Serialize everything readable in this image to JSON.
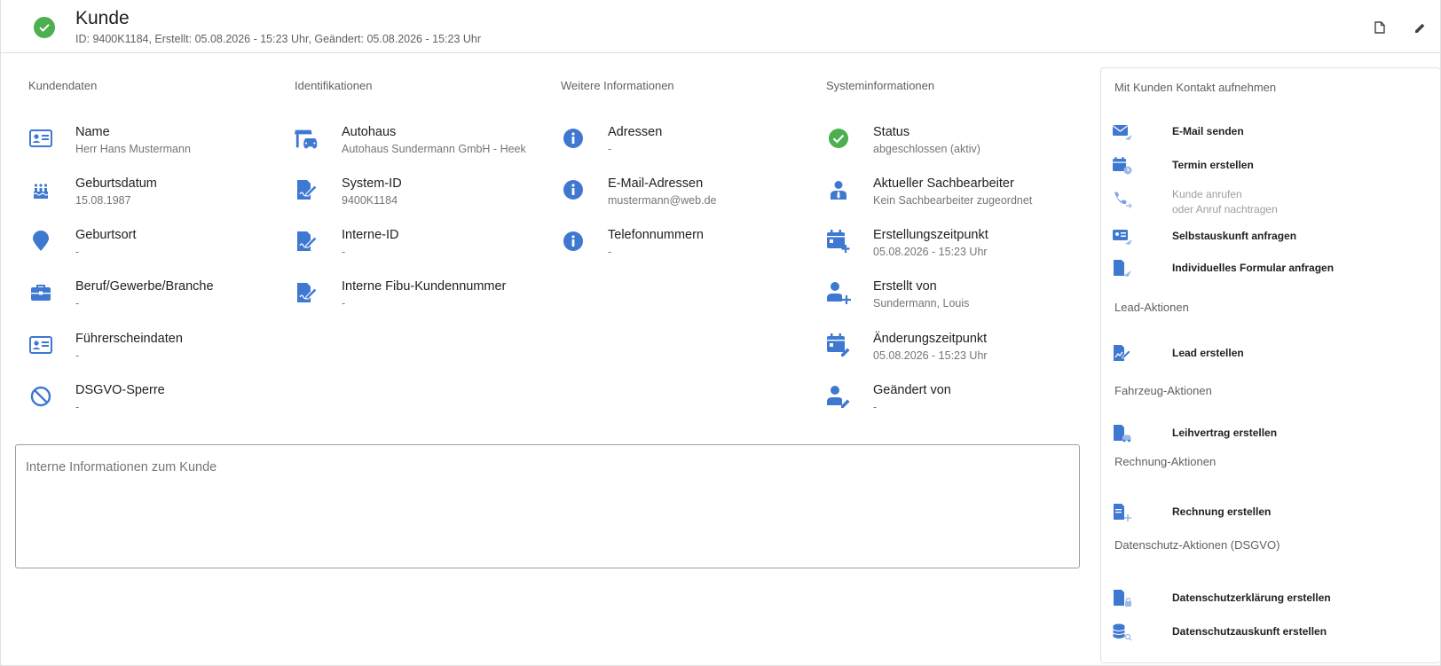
{
  "header": {
    "title": "Kunde",
    "subtitle": "ID: 9400K1184, Erstellt: 05.08.2026 - 15:23 Uhr, Geändert: 05.08.2026 - 15:23 Uhr"
  },
  "columns": [
    {
      "title": "Kundendaten",
      "items": [
        {
          "label": "Name",
          "value": "Herr Hans Mustermann",
          "icon": "id-card-icon"
        },
        {
          "label": "Geburtsdatum",
          "value": "15.08.1987",
          "icon": "cake-icon"
        },
        {
          "label": "Geburtsort",
          "value": "-",
          "icon": "location-pin-icon"
        },
        {
          "label": "Beruf/Gewerbe/Branche",
          "value": "-",
          "icon": "briefcase-icon"
        },
        {
          "label": "Führerscheindaten",
          "value": "-",
          "icon": "license-card-icon"
        },
        {
          "label": "DSGVO-Sperre",
          "value": "-",
          "icon": "block-icon"
        }
      ]
    },
    {
      "title": "Identifikationen",
      "items": [
        {
          "label": "Autohaus",
          "value": "Autohaus Sundermann GmbH - Heek",
          "icon": "car-dealership-icon"
        },
        {
          "label": "System-ID",
          "value": "9400K1184",
          "icon": "document-sign-icon"
        },
        {
          "label": "Interne-ID",
          "value": "-",
          "icon": "document-sign-icon"
        },
        {
          "label": "Interne Fibu-Kundennummer",
          "value": "-",
          "icon": "document-sign-icon"
        }
      ]
    },
    {
      "title": "Weitere Informationen",
      "items": [
        {
          "label": "Adressen",
          "value": "-",
          "icon": "info-icon"
        },
        {
          "label": "E-Mail-Adressen",
          "value": "mustermann@web.de",
          "icon": "info-icon"
        },
        {
          "label": "Telefonnummern",
          "value": "-",
          "icon": "info-icon"
        }
      ]
    },
    {
      "title": "Systeminformationen",
      "items": [
        {
          "label": "Status",
          "value": "abgeschlossen (aktiv)",
          "icon": "check-circle-icon"
        },
        {
          "label": "Aktueller Sachbearbeiter",
          "value": "Kein Sachbearbeiter zugeordnet",
          "icon": "agent-icon"
        },
        {
          "label": "Erstellungszeitpunkt",
          "value": "05.08.2026 - 15:23 Uhr",
          "icon": "calendar-add-icon"
        },
        {
          "label": "Erstellt von",
          "value": "Sundermann, Louis",
          "icon": "person-add-icon"
        },
        {
          "label": "Änderungszeitpunkt",
          "value": "05.08.2026 - 15:23 Uhr",
          "icon": "calendar-edit-icon"
        },
        {
          "label": "Geändert von",
          "value": "-",
          "icon": "person-edit-icon"
        }
      ]
    }
  ],
  "notes": {
    "placeholder": "Interne Informationen zum Kunde"
  },
  "panel": {
    "contact_title": "Mit Kunden Kontakt aufnehmen",
    "contact_actions": [
      {
        "label": "E-Mail senden",
        "icon": "email-send-icon"
      },
      {
        "label": "Termin erstellen",
        "icon": "calendar-time-icon"
      },
      {
        "label": "Kunde anrufen",
        "label2": "oder Anruf nachtragen",
        "icon": "phone-icon",
        "disabled": true
      },
      {
        "label": "Selbstauskunft anfragen",
        "icon": "self-disclosure-icon"
      },
      {
        "label": "Individuelles Formular anfragen",
        "icon": "form-request-icon"
      }
    ],
    "lead_title": "Lead-Aktionen",
    "lead_actions": [
      {
        "label": "Lead erstellen",
        "icon": "lead-icon"
      }
    ],
    "vehicle_title": "Fahrzeug-Aktionen",
    "vehicle_actions": [
      {
        "label": "Leihvertrag erstellen",
        "icon": "loan-contract-icon"
      }
    ],
    "invoice_title": "Rechnung-Aktionen",
    "invoice_actions": [
      {
        "label": "Rechnung erstellen",
        "icon": "invoice-icon"
      }
    ],
    "privacy_title": "Datenschutz-Aktionen (DSGVO)",
    "privacy_actions": [
      {
        "label": "Datenschutzerklärung erstellen",
        "icon": "privacy-document-icon"
      },
      {
        "label": "Datenschutzauskunft erstellen",
        "icon": "database-search-icon"
      }
    ]
  },
  "colors": {
    "accent": "#3f78d1",
    "success": "#4caf50",
    "muted": "#757575"
  }
}
